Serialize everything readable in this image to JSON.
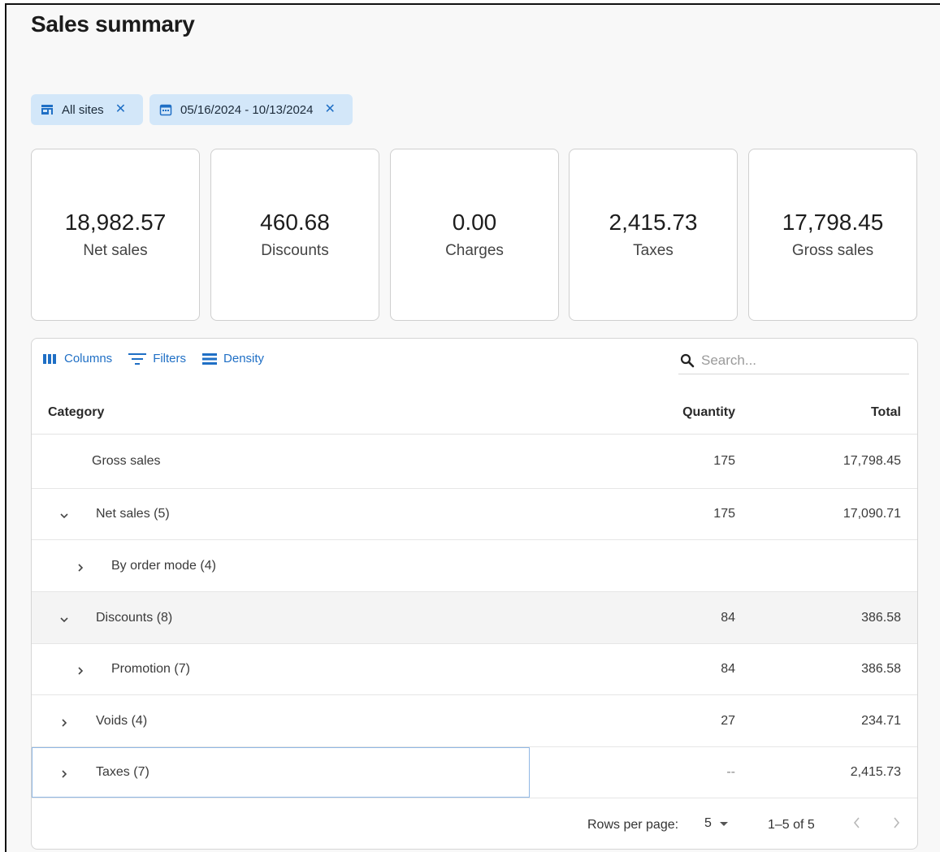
{
  "page": {
    "title": "Sales summary"
  },
  "filters": [
    {
      "label": "All sites",
      "icon": "store-icon"
    },
    {
      "label": "05/16/2024 - 10/13/2024",
      "icon": "calendar-icon"
    }
  ],
  "cards": [
    {
      "value": "18,982.57",
      "label": "Net sales"
    },
    {
      "value": "460.68",
      "label": "Discounts"
    },
    {
      "value": "0.00",
      "label": "Charges"
    },
    {
      "value": "2,415.73",
      "label": "Taxes"
    },
    {
      "value": "17,798.45",
      "label": "Gross sales"
    }
  ],
  "toolbar": {
    "columns": "Columns",
    "filters": "Filters",
    "density": "Density"
  },
  "search": {
    "placeholder": "Search..."
  },
  "table": {
    "headers": {
      "category": "Category",
      "quantity": "Quantity",
      "total": "Total"
    },
    "rows": [
      {
        "category": "Gross sales",
        "quantity": "175",
        "total": "17,798.45"
      },
      {
        "category": "Net sales (5)",
        "quantity": "175",
        "total": "17,090.71"
      },
      {
        "category": "By order mode (4)",
        "quantity": "",
        "total": ""
      },
      {
        "category": "Discounts (8)",
        "quantity": "84",
        "total": "386.58"
      },
      {
        "category": "Promotion (7)",
        "quantity": "84",
        "total": "386.58"
      },
      {
        "category": "Voids (4)",
        "quantity": "27",
        "total": "234.71"
      },
      {
        "category": "Taxes (7)",
        "quantity": "--",
        "total": "2,415.73"
      }
    ]
  },
  "pagination": {
    "rows_per_page_label": "Rows per page:",
    "rows_per_page": "5",
    "range": "1–5 of 5"
  }
}
